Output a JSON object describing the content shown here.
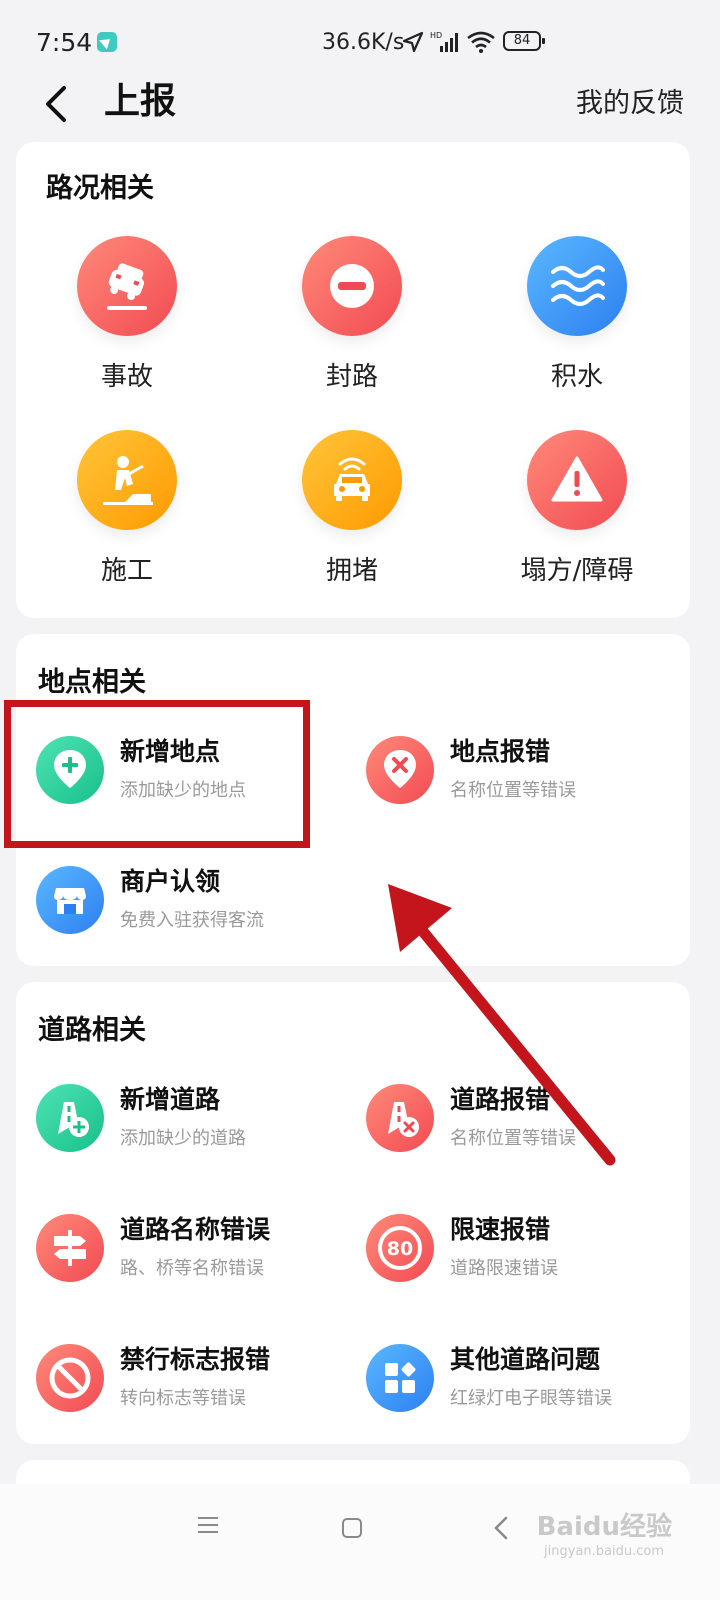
{
  "status_bar": {
    "time": "7:54",
    "network_speed": "36.6K/s",
    "battery": "84",
    "hd_label": "HD"
  },
  "header": {
    "title": "上报",
    "feedback": "我的反馈"
  },
  "road_condition": {
    "title": "路况相关",
    "items": [
      {
        "label": "事故",
        "icon": "accident-car-icon",
        "color": "#f24a52"
      },
      {
        "label": "封路",
        "icon": "road-closed-icon",
        "color": "#f24a52"
      },
      {
        "label": "积水",
        "icon": "water-icon",
        "color": "#2d7ff0"
      },
      {
        "label": "施工",
        "icon": "construction-icon",
        "color": "#ff9a00"
      },
      {
        "label": "拥堵",
        "icon": "traffic-jam-icon",
        "color": "#ff9a00"
      },
      {
        "label": "塌方/障碍",
        "icon": "warning-icon",
        "color": "#f24a52"
      }
    ]
  },
  "place": {
    "title": "地点相关",
    "items": [
      {
        "title": "新增地点",
        "subtitle": "添加缺少的地点",
        "icon": "add-location-icon",
        "color": "#18c08a"
      },
      {
        "title": "地点报错",
        "subtitle": "名称位置等错误",
        "icon": "location-error-icon",
        "color": "#f24a52"
      },
      {
        "title": "商户认领",
        "subtitle": "免费入驻获得客流",
        "icon": "store-icon",
        "color": "#2d7ff0"
      }
    ]
  },
  "road": {
    "title": "道路相关",
    "items": [
      {
        "title": "新增道路",
        "subtitle": "添加缺少的道路",
        "icon": "add-road-icon",
        "color": "#18c08a"
      },
      {
        "title": "道路报错",
        "subtitle": "名称位置等错误",
        "icon": "road-error-icon",
        "color": "#f24a52"
      },
      {
        "title": "道路名称错误",
        "subtitle": "路、桥等名称错误",
        "icon": "signpost-icon",
        "color": "#f24a52"
      },
      {
        "title": "限速报错",
        "subtitle": "道路限速错误",
        "icon": "speed-limit-icon",
        "color": "#f24a52",
        "icon_text": "80"
      },
      {
        "title": "禁行标志报错",
        "subtitle": "转向标志等错误",
        "icon": "no-entry-icon",
        "color": "#f24a52"
      },
      {
        "title": "其他道路问题",
        "subtitle": "红绿灯电子眼等错误",
        "icon": "apps-icon",
        "color": "#2d7ff0"
      }
    ]
  },
  "watermark": {
    "text": "Baidu经验",
    "sub": "jingyan.baidu.com"
  }
}
